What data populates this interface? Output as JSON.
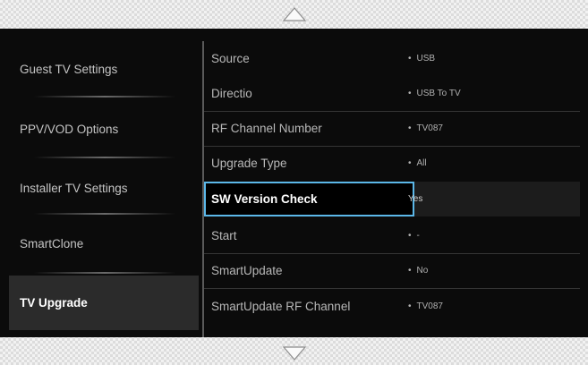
{
  "menu": {
    "categories": [
      {
        "label": "Guest TV Settings"
      },
      {
        "label": "PPV/VOD Options"
      },
      {
        "label": "Installer TV Settings"
      },
      {
        "label": "SmartClone"
      },
      {
        "label": "TV Upgrade"
      }
    ],
    "selected_category": "TV Upgrade"
  },
  "settings": {
    "rows": [
      {
        "label": "Source",
        "value": "USB"
      },
      {
        "label": "Directio",
        "value": "USB To TV"
      },
      {
        "label": "RF Channel Number",
        "value": "TV087"
      },
      {
        "label": "Upgrade Type",
        "value": "All"
      },
      {
        "label": "SW Version Check",
        "value": "Yes"
      },
      {
        "label": "Start",
        "value": "-"
      },
      {
        "label": "SmartUpdate",
        "value": "No"
      },
      {
        "label": "SmartUpdate RF Channel",
        "value": "TV087"
      }
    ],
    "focused_row": "SW Version Check",
    "bullet": "•"
  },
  "colors": {
    "panel_bg": "#0b0b0b",
    "focus_border": "#5bb7e8",
    "selected_item_bg": "#2b2b2b"
  },
  "icons": {
    "scroll_up": "scroll-up-arrow-icon",
    "scroll_down": "scroll-down-arrow-icon"
  }
}
